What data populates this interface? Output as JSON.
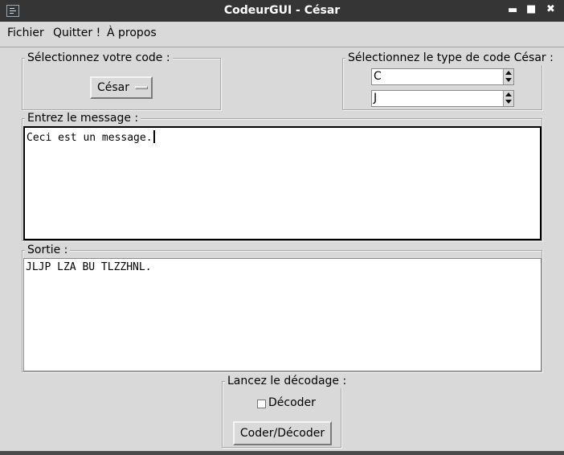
{
  "window": {
    "title": "CodeurGUI - César"
  },
  "menu": {
    "items": [
      "Fichier",
      "Quitter !",
      "À propos"
    ]
  },
  "code_group": {
    "legend": "Sélectionnez votre code :",
    "selected": "César"
  },
  "type_group": {
    "legend": "Sélectionnez le type de code César :",
    "spin1_value": "C",
    "spin2_value": "J"
  },
  "input_group": {
    "legend": "Entrez le message :",
    "text": "Ceci est un message."
  },
  "output_group": {
    "legend": "Sortie :",
    "text": "JLJP LZA BU TLZZHNL."
  },
  "decode_group": {
    "legend": "Lancez le décodage :",
    "checkbox_label": "Décoder",
    "checkbox_checked": false,
    "button_label": "Coder/Décoder"
  }
}
